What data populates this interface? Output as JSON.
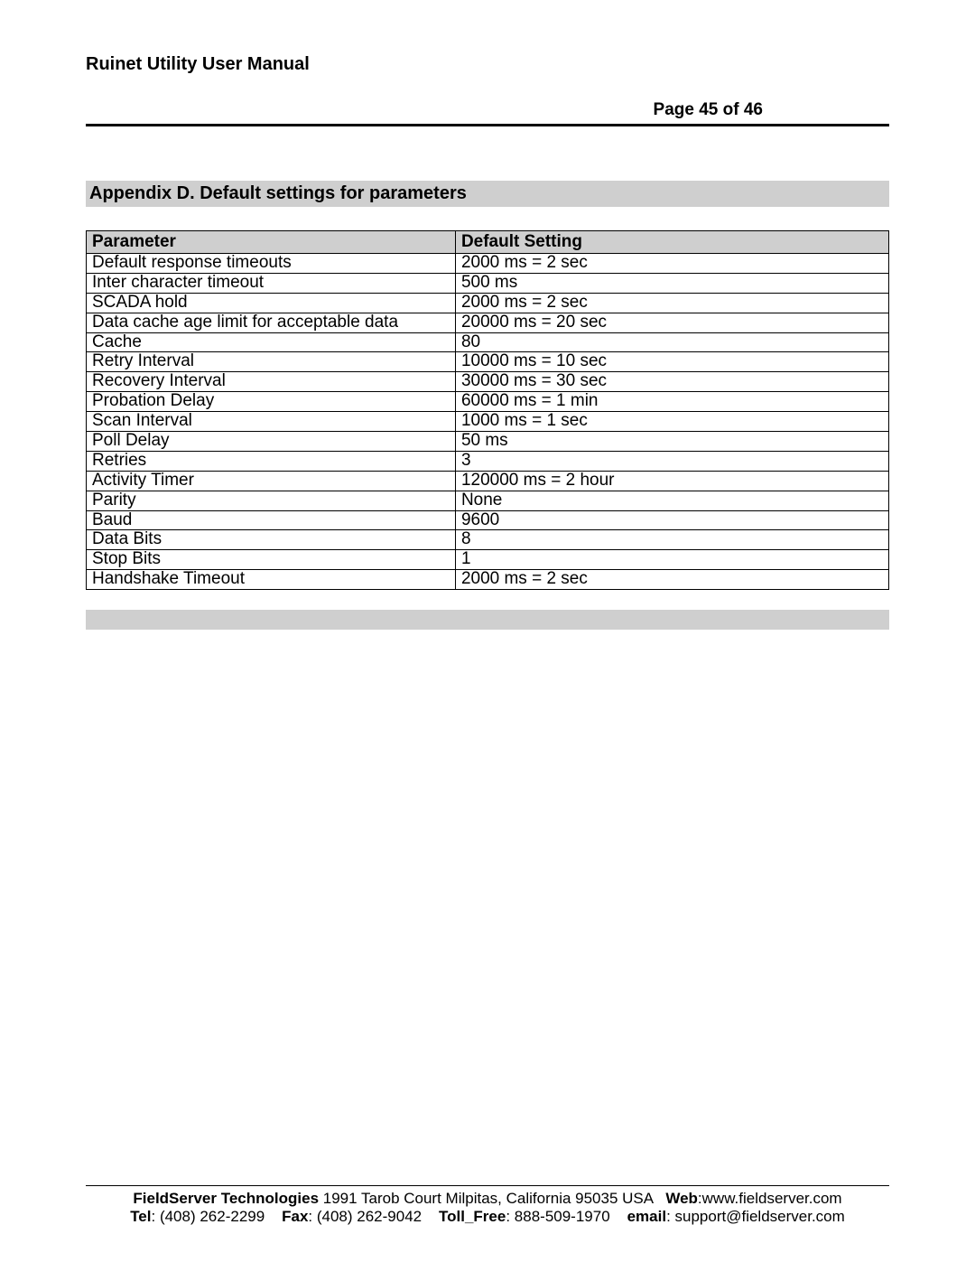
{
  "header": {
    "doc_title": "Ruinet Utility User Manual",
    "page_number": "Page 45 of 46"
  },
  "section": {
    "title": "Appendix D. Default settings for parameters"
  },
  "table": {
    "headers": {
      "col1": "Parameter",
      "col2": "Default Setting"
    },
    "rows": [
      {
        "param": "Default response timeouts",
        "value": "2000 ms = 2 sec"
      },
      {
        "param": "Inter character timeout",
        "value": "500 ms"
      },
      {
        "param": "SCADA hold",
        "value": "2000 ms = 2 sec"
      },
      {
        "param": "Data cache age limit for acceptable data",
        "value": "20000 ms = 20 sec"
      },
      {
        "param": "Cache",
        "value": "80"
      },
      {
        "param": "Retry Interval",
        "value": "10000 ms = 10 sec"
      },
      {
        "param": "Recovery Interval",
        "value": "30000 ms = 30 sec"
      },
      {
        "param": "Probation Delay",
        "value": "60000 ms = 1 min"
      },
      {
        "param": "Scan Interval",
        "value": "1000 ms = 1 sec"
      },
      {
        "param": "Poll Delay",
        "value": "50 ms"
      },
      {
        "param": "Retries",
        "value": "3"
      },
      {
        "param": "Activity Timer",
        "value": "120000 ms = 2 hour"
      },
      {
        "param": "Parity",
        "value": "None"
      },
      {
        "param": "Baud",
        "value": "9600"
      },
      {
        "param": "Data Bits",
        "value": "8"
      },
      {
        "param": "Stop Bits",
        "value": "1"
      },
      {
        "param": "Handshake Timeout",
        "value": "2000 ms = 2 sec"
      }
    ]
  },
  "footer": {
    "company": "FieldServer Technologies",
    "address": "1991 Tarob Court Milpitas, California 95035 USA",
    "web_label": "Web",
    "web_sep": ":",
    "web_value": "www.fieldserver.com",
    "tel_label": "Tel",
    "tel_value": ": (408) 262-2299",
    "fax_label": "Fax",
    "fax_value": ": (408) 262-9042",
    "toll_label": "Toll_Free",
    "toll_value": ": 888-509-1970",
    "email_label": "email",
    "email_value": ": support@fieldserver.com"
  }
}
